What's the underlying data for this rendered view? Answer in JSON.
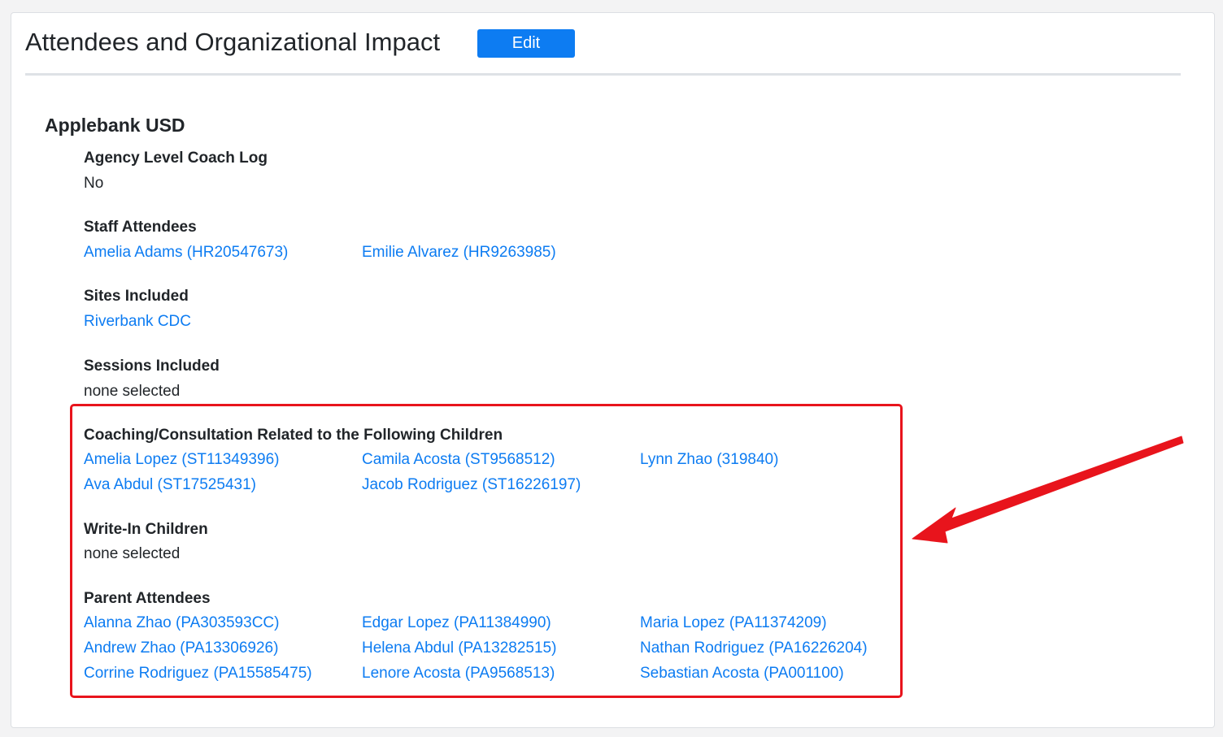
{
  "header": {
    "title": "Attendees and Organizational Impact",
    "edit_label": "Edit"
  },
  "organization": {
    "name": "Applebank USD"
  },
  "agency_level": {
    "label": "Agency Level Coach Log",
    "value": "No"
  },
  "staff": {
    "label": "Staff Attendees",
    "items": [
      "Amelia Adams (HR20547673)",
      "Emilie Alvarez (HR9263985)"
    ]
  },
  "sites": {
    "label": "Sites Included",
    "items": [
      "Riverbank CDC"
    ]
  },
  "sessions": {
    "label": "Sessions Included",
    "value": "none selected"
  },
  "children": {
    "label": "Coaching/Consultation Related to the Following Children",
    "items": [
      "Amelia Lopez (ST11349396)",
      "Camila Acosta (ST9568512)",
      "Lynn Zhao (319840)",
      "Ava Abdul (ST17525431)",
      "Jacob Rodriguez (ST16226197)"
    ]
  },
  "write_in": {
    "label": "Write-In Children",
    "value": "none selected"
  },
  "parents": {
    "label": "Parent Attendees",
    "items": [
      "Alanna Zhao (PA303593CC)",
      "Edgar Lopez (PA11384990)",
      "Maria Lopez (PA11374209)",
      "Andrew Zhao (PA13306926)",
      "Helena Abdul (PA13282515)",
      "Nathan Rodriguez (PA16226204)",
      "Corrine Rodriguez (PA15585475)",
      "Lenore Acosta (PA9568513)",
      "Sebastian Acosta (PA001100)"
    ]
  },
  "annotation": {
    "highlight_color": "#e8141c",
    "arrow_icon": "red-arrow-icon"
  },
  "colors": {
    "link": "#0d7cf2",
    "button": "#0d7cf2"
  }
}
